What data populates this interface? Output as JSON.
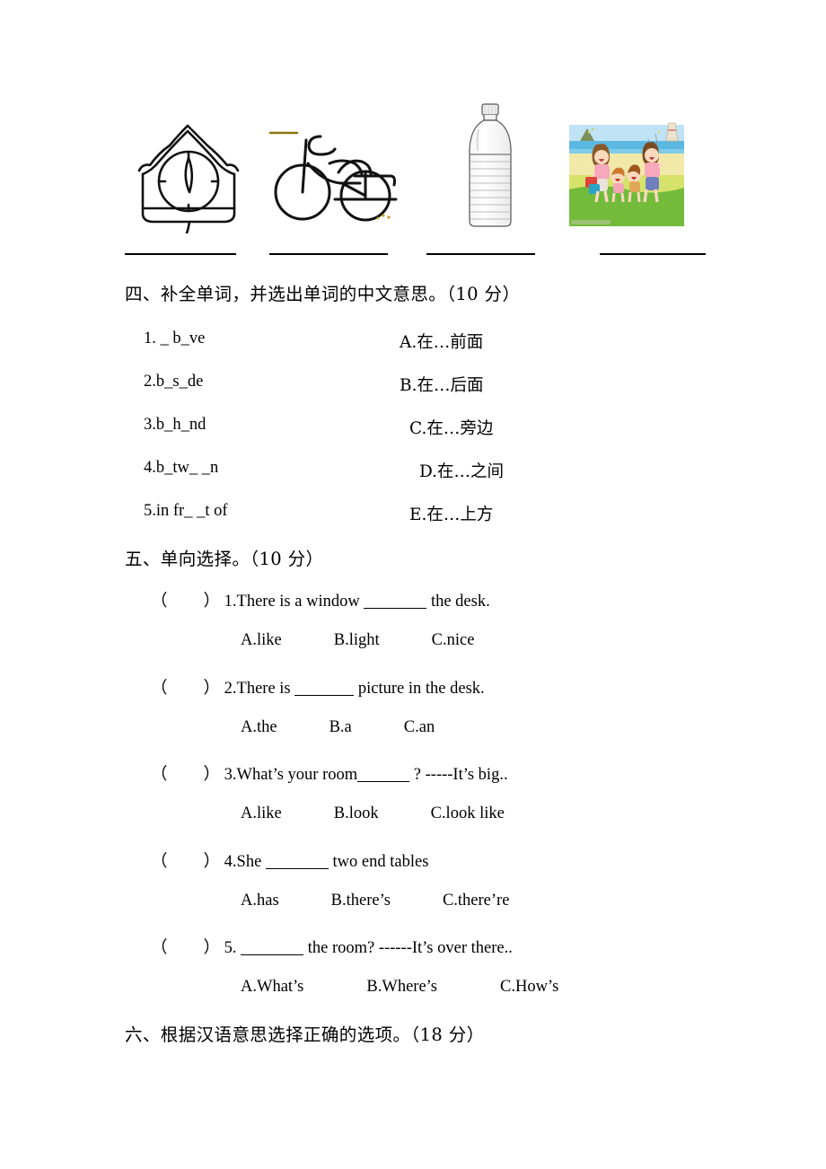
{
  "document": {
    "type": "english-exam-worksheet",
    "page_background": "#ffffff",
    "ink_color": "#000000"
  },
  "picture_row": {
    "instruction_visible": false,
    "pictures": [
      {
        "name": "cuckoo-clock",
        "alt": "line drawing of a cuckoo wall clock",
        "answer_line": true
      },
      {
        "name": "bicycle",
        "alt": "line drawing of a bicycle",
        "answer_line": true
      },
      {
        "name": "water-bottle",
        "alt": "photo of a plastic water bottle",
        "answer_line": true
      },
      {
        "name": "family-on-beach",
        "alt": "cartoon of a family running on a grassy beach",
        "answer_line": true
      }
    ]
  },
  "section_four": {
    "heading": "四、补全单词，并选出单词的中文意思。（10 分）",
    "items": [
      {
        "number": "1.",
        "word": "_ b_ve",
        "option_letter": "A.",
        "option_text": "在…前面"
      },
      {
        "number": "2.",
        "word": "b_s_de",
        "option_letter": "B.",
        "option_text": "在…后面"
      },
      {
        "number": "3.",
        "word": "b_h_nd",
        "option_letter": "C.",
        "option_text": "在…旁边"
      },
      {
        "number": "4.",
        "word": "b_tw_ _n",
        "option_letter": "D.",
        "option_text": "在…之间"
      },
      {
        "number": "5.",
        "word": "in fr_ _t of",
        "option_letter": "E.",
        "option_text": "在…上方"
      }
    ],
    "item_lines": [
      "1. _ b_ve",
      "2.b_s_de",
      "3.b_h_nd",
      "4.b_tw_ _n",
      "5.in fr_ _t of"
    ],
    "option_lines": [
      "A.在…前面",
      "B.在…后面",
      "C.在…旁边",
      "D.在…之间",
      "E.在…上方"
    ]
  },
  "section_five": {
    "heading": "五、单向选择。（10 分）",
    "bracket_open": "（",
    "bracket_close": "）",
    "questions": [
      {
        "number": "1.",
        "before_blank": "There is a window ",
        "after_blank": " the desk.",
        "choices": [
          "A.like",
          "B.light",
          "C.nice"
        ]
      },
      {
        "number": "2.",
        "before_blank": "There is ",
        "after_blank": " picture in the desk.",
        "choices": [
          "A.the",
          "B.a",
          "C.an"
        ]
      },
      {
        "number": "3.",
        "before_blank": "What’s your room",
        "after_blank": " ?    -----It’s big..",
        "choices": [
          "A.like",
          "B.look",
          "C.look like"
        ]
      },
      {
        "number": "4.",
        "before_blank": "She ",
        "after_blank": " two end tables",
        "choices": [
          "A.has",
          "B.there’s",
          "C.there’re"
        ]
      },
      {
        "number": "5.",
        "before_blank": " ",
        "after_blank": " the room?    ------It’s over there..",
        "choices": [
          "A.What’s",
          "B.Where’s",
          "C.How’s"
        ]
      }
    ]
  },
  "section_six": {
    "heading": "六、根据汉语意思选择正确的选项。（18 分）"
  }
}
